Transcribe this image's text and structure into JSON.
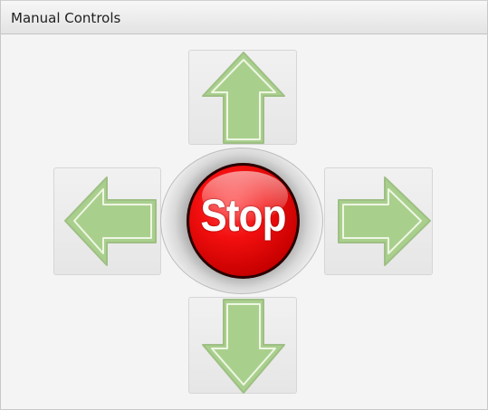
{
  "panel": {
    "title": "Manual Controls"
  },
  "controls": {
    "stop_label": "Stop",
    "up_icon": "arrow-up-icon",
    "down_icon": "arrow-down-icon",
    "left_icon": "arrow-left-icon",
    "right_icon": "arrow-right-icon"
  },
  "colors": {
    "arrow_fill": "#a9cf8d",
    "arrow_stroke": "#f3f7ea",
    "stop_red": "#e00000",
    "header_bg": "#e8e8e8",
    "panel_bg": "#f4f4f4"
  }
}
